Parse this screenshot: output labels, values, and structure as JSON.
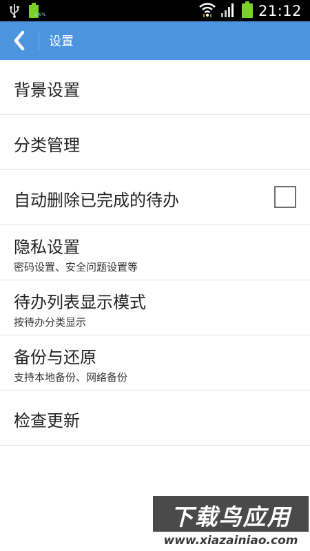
{
  "status_bar": {
    "time": "21:12",
    "battery_percent_label": "100%",
    "icons": [
      "usb-icon",
      "battery-full-icon",
      "wifi-icon",
      "signal-icon",
      "battery-charging-icon"
    ]
  },
  "app_bar": {
    "title": "设置",
    "back_icon": "chevron-left-icon",
    "color": "#4c95de"
  },
  "settings": [
    {
      "title": "背景设置"
    },
    {
      "title": "分类管理"
    },
    {
      "title": "自动删除已完成的待办",
      "checkbox_checked": false
    },
    {
      "title": "隐私设置",
      "subtitle": "密码设置、安全问题设置等"
    },
    {
      "title": "待办列表显示模式",
      "subtitle": "按待办分类显示"
    },
    {
      "title": "备份与还原",
      "subtitle": "支持本地备份、网络备份"
    },
    {
      "title": "检查更新"
    }
  ],
  "watermark": {
    "top_text": "下载鸟应用",
    "url": "www.xiazainiao.com"
  }
}
